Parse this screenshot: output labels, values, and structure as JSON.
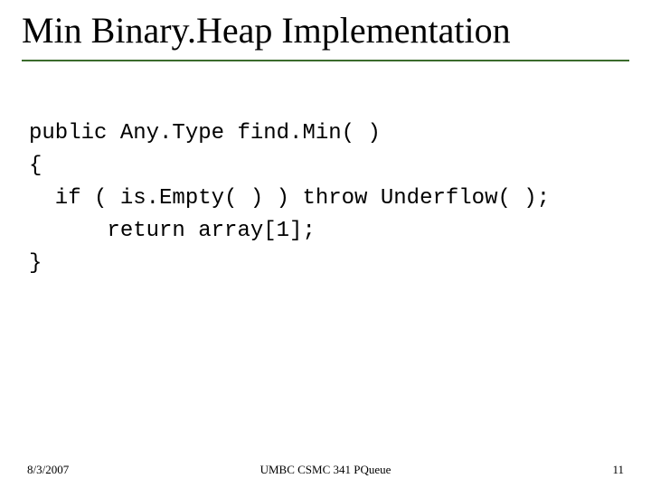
{
  "title": "Min Binary.Heap Implementation",
  "code": {
    "line1": "public Any.Type find.Min( )",
    "line2": "{",
    "line3": "  if ( is.Empty( ) ) throw Underflow( );",
    "line4": "      return array[1];",
    "line5": "}"
  },
  "footer": {
    "date": "8/3/2007",
    "center": "UMBC CSMC 341 PQueue",
    "page": "11"
  }
}
